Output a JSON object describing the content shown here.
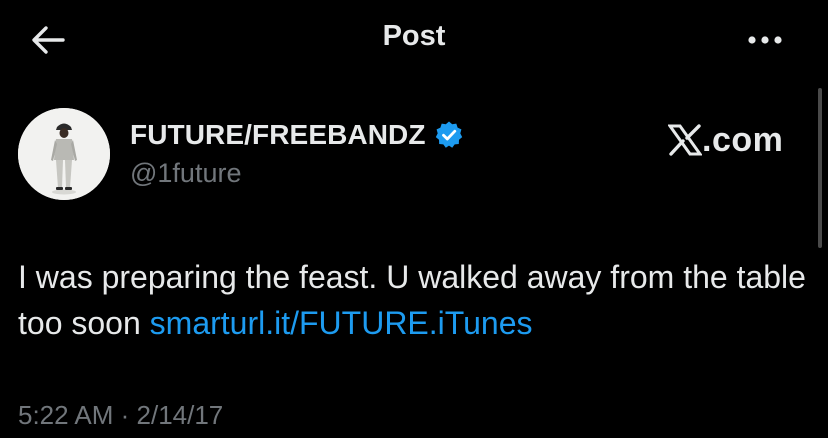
{
  "header": {
    "title": "Post",
    "back_icon": "arrow-left-icon",
    "more_icon": "ellipsis-icon"
  },
  "author": {
    "display_name": "FUTURE/FREEBANDZ",
    "handle": "@1future",
    "verified_icon": "verified-badge-icon",
    "verified_color": "#1d9bf0"
  },
  "watermark": {
    "text": "com",
    "logo_icon": "x-logo-icon"
  },
  "post": {
    "text": "I was preparing the feast. U walked away from the table too soon ",
    "link": "smarturl.it/FUTURE.iTunes",
    "link_color": "#1d9bf0"
  },
  "meta": {
    "time": "5:22 AM",
    "separator": " · ",
    "date": "2/14/17"
  },
  "colors": {
    "background": "#000000",
    "primary_text": "#e7e9ea",
    "secondary_text": "#71767b"
  }
}
